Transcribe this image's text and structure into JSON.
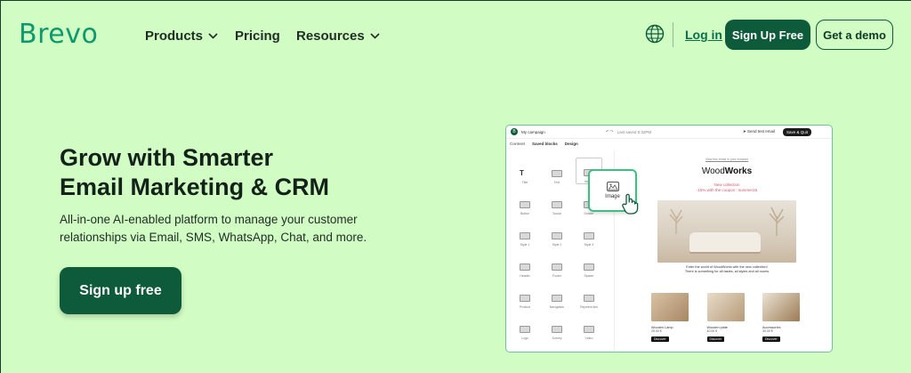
{
  "nav": {
    "logo": "Brevo",
    "products": "Products",
    "pricing": "Pricing",
    "resources": "Resources",
    "login": "Log in",
    "signup": "Sign Up Free",
    "demo": "Get a demo"
  },
  "hero": {
    "title_line1": "Grow with Smarter",
    "title_line2": "Email Marketing & CRM",
    "subtitle": "All-in-one AI-enabled platform to manage your customer relationships via Email, SMS, WhatsApp, Chat, and more.",
    "cta": "Sign up free"
  },
  "mockup": {
    "avatar": "B",
    "campaign": "My campaign",
    "last_saved": "Last saved 8:32PM",
    "send_test": "Send test email",
    "save_quit": "Save & Quit",
    "tabs": [
      "Content",
      "Saved blocks",
      "Design"
    ],
    "blocks": [
      "Title",
      "Text",
      "Image",
      "Button",
      "Social",
      "Divider",
      "Style 1",
      "Style 2",
      "Style 3",
      "Header",
      "Footer",
      "Spacer",
      "Product",
      "Navigation",
      "Payment link",
      "Logo",
      "Survey",
      "Video"
    ],
    "drag_card": "Image",
    "online_link": "View this email in your browser",
    "brand_plain": "Wood",
    "brand_bold": "Works",
    "promo_line1": "New collection",
    "promo_line2": "-15% with the coupon : summer15",
    "desc_line1": "Enter the world of WoodWorks with the new collection!",
    "desc_line2": "There is something for all tastes, all styles and all rooms",
    "products": [
      {
        "name": "Wooden Lamp",
        "price": "25.00 €",
        "cta": "Discover"
      },
      {
        "name": "Wooden plate",
        "price": "40.00 €",
        "cta": "Discover"
      },
      {
        "name": "Accessories",
        "price": "30.00 €",
        "cta": "Discover"
      }
    ]
  },
  "colors": {
    "background": "#d1fcc3",
    "brand_green": "#0b996e",
    "button_dark": "#0d5b3a",
    "promo_pink": "#d15a6a"
  }
}
